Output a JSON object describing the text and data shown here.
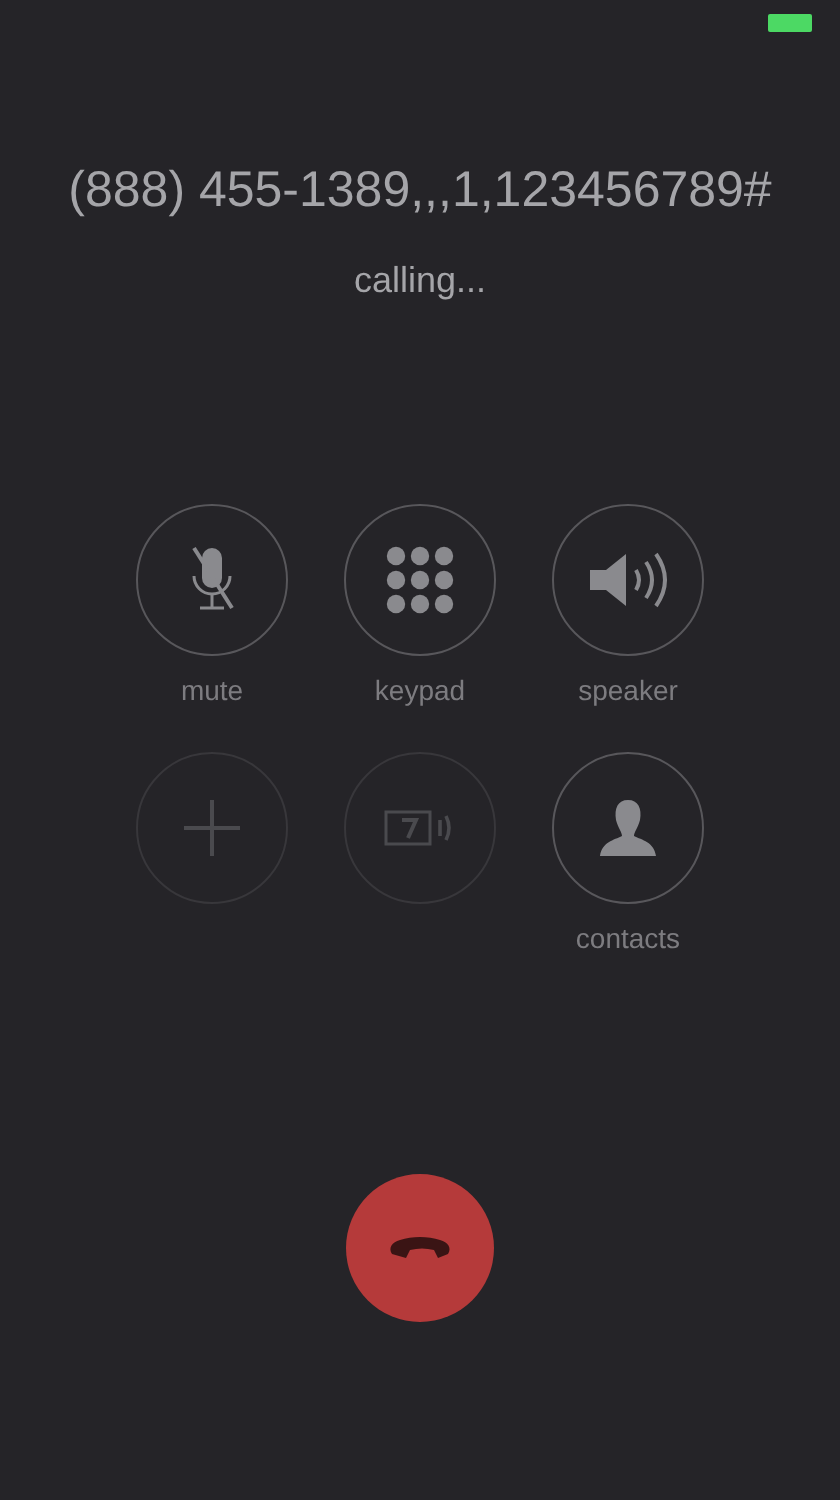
{
  "number": "(888) 455-1389,,,1,123456789#",
  "status": "calling...",
  "buttons": [
    {
      "kind": "mute",
      "label": "mute",
      "disabled": false
    },
    {
      "kind": "keypad",
      "label": "keypad",
      "disabled": false
    },
    {
      "kind": "speaker",
      "label": "speaker",
      "disabled": false
    },
    {
      "kind": "add",
      "disabled": true
    },
    {
      "kind": "tty",
      "disabled": true
    },
    {
      "kind": "contacts",
      "label": "contacts",
      "disabled": false
    }
  ],
  "end_call": {
    "kind": "end"
  }
}
